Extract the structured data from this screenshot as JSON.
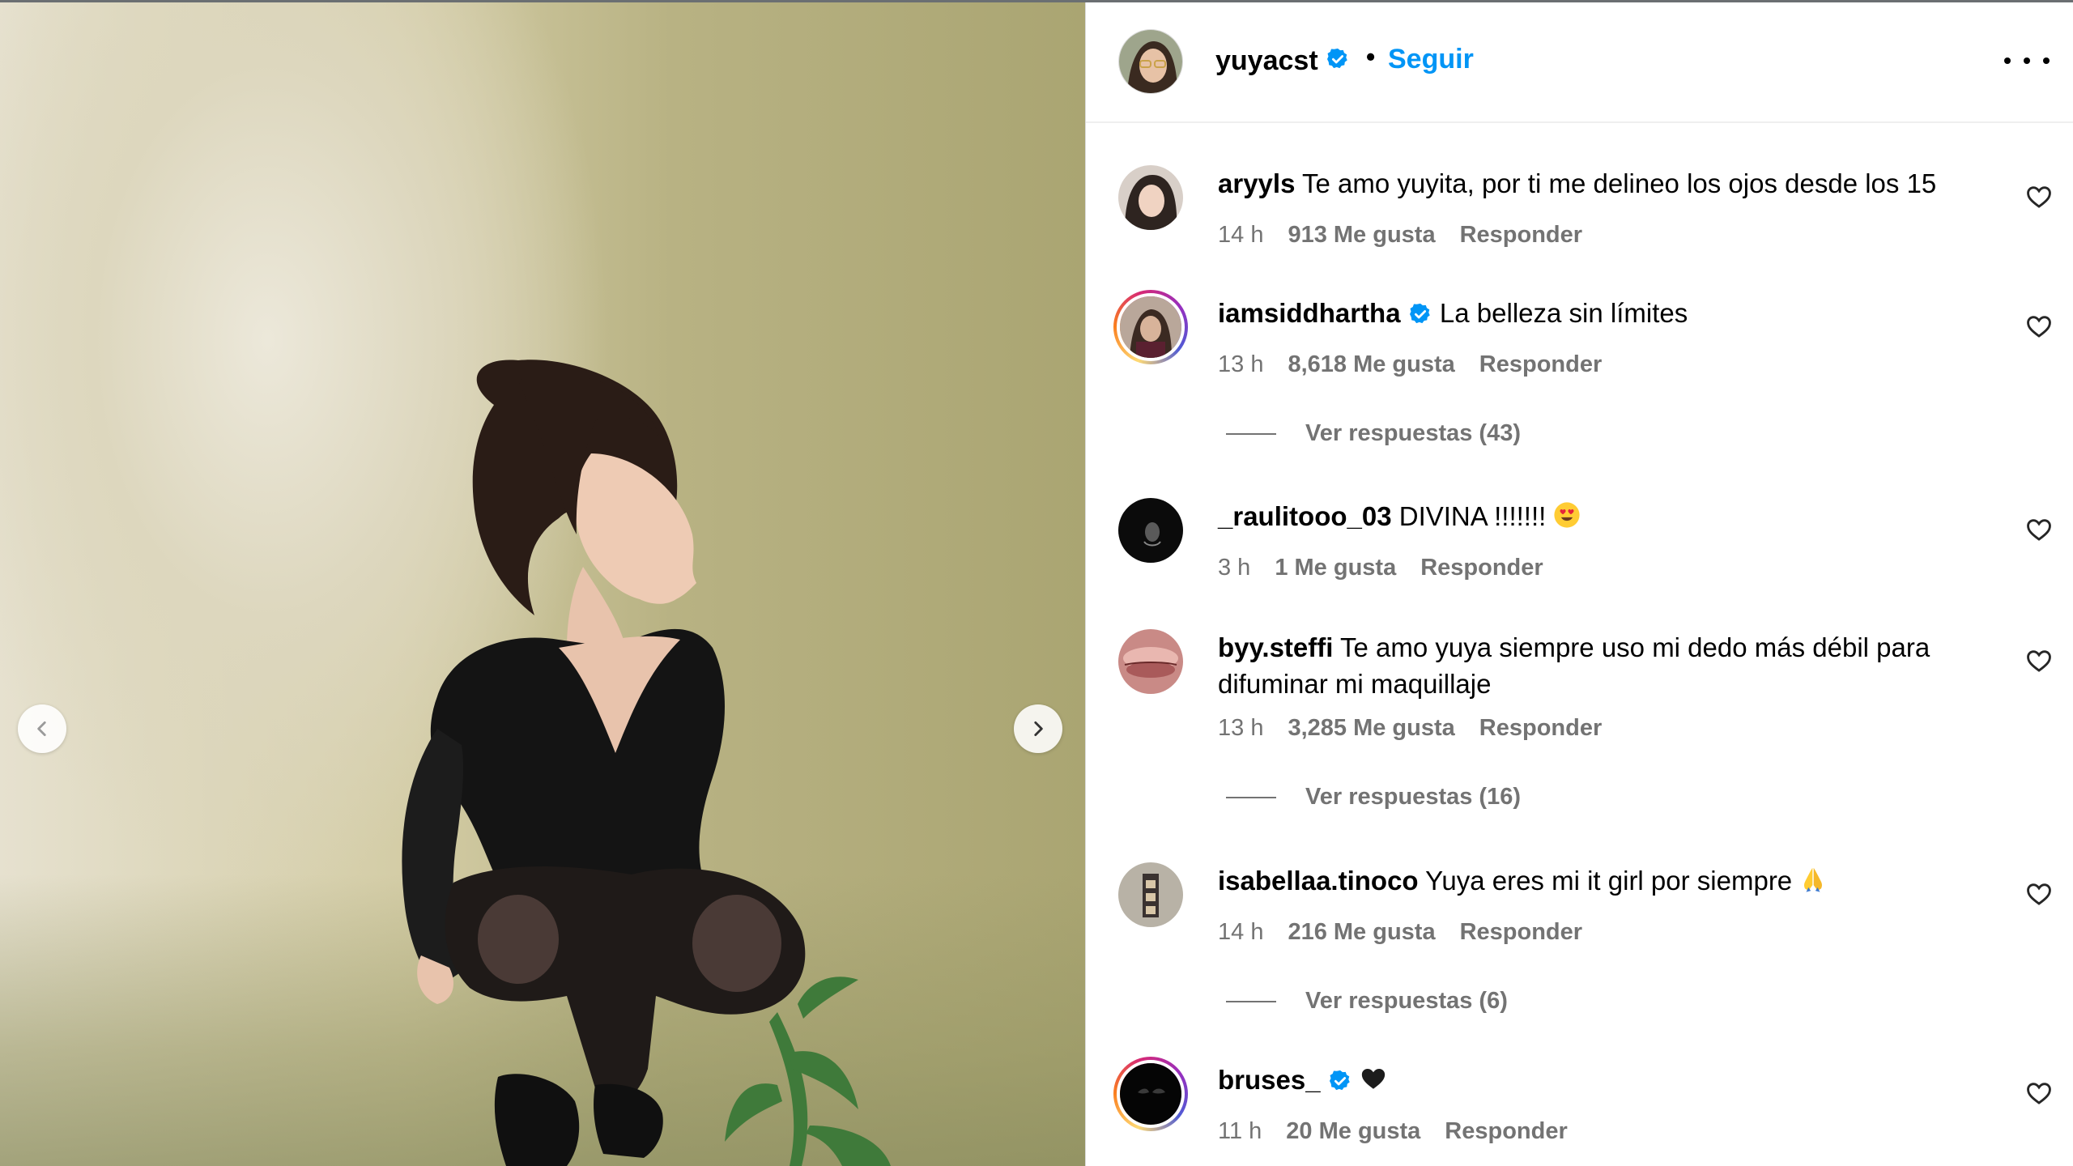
{
  "post": {
    "username": "yuyacst",
    "verified": true,
    "follow_label": "Seguir",
    "separator": "•"
  },
  "comments": [
    {
      "username": "aryyls",
      "verified": false,
      "text": "Te amo yuyita, por ti me delineo los ojos desde los 15",
      "time": "14 h",
      "likes": "913 Me gusta",
      "reply_label": "Responder",
      "replies": null
    },
    {
      "username": "iamsiddhartha",
      "verified": true,
      "text": "La belleza sin límites",
      "time": "13 h",
      "likes": "8,618 Me gusta",
      "reply_label": "Responder",
      "replies": "Ver respuestas (43)",
      "story_ring": true
    },
    {
      "username": "_raulitooo_03",
      "verified": false,
      "text": "DIVINA !!!!!!!",
      "emoji": "heart-eyes",
      "time": "3 h",
      "likes": "1 Me gusta",
      "reply_label": "Responder",
      "replies": null
    },
    {
      "username": "byy.steffi",
      "verified": false,
      "text": "Te amo yuya siempre uso mi dedo más débil para difuminar mi maquillaje",
      "time": "13 h",
      "likes": "3,285 Me gusta",
      "reply_label": "Responder",
      "replies": "Ver respuestas (16)"
    },
    {
      "username": "isabellaa.tinoco",
      "verified": false,
      "text": "Yuya eres mi it girl por siempre",
      "emoji": "folded-hands",
      "time": "14 h",
      "likes": "216 Me gusta",
      "reply_label": "Responder",
      "replies": "Ver respuestas (6)"
    },
    {
      "username": "bruses_",
      "verified": true,
      "text": "",
      "emoji": "black-heart",
      "time": "11 h",
      "likes": "20 Me gusta",
      "reply_label": "Responder",
      "replies": null,
      "story_ring": true
    }
  ],
  "colors": {
    "accent": "#0095f6",
    "verified": "#0095f6",
    "meta": "#737373"
  },
  "icons": {
    "prev": "chevron-left-icon",
    "next": "chevron-right-icon",
    "more": "more-options-icon",
    "like": "heart-outline-icon",
    "verified": "verified-badge-icon"
  }
}
